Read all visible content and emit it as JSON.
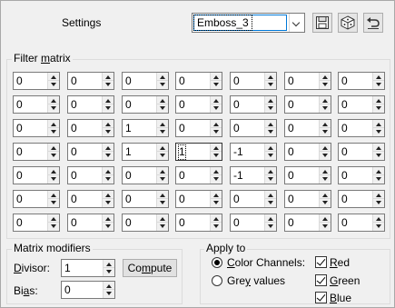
{
  "header": {
    "label": "Settings",
    "preset_value": "Emboss_3",
    "buttons": [
      "save-preset",
      "randomize",
      "reset"
    ]
  },
  "filter_matrix": {
    "title_prefix": "Filter ",
    "title_underlined": "m",
    "title_suffix": "atrix",
    "rows": [
      [
        "0",
        "0",
        "0",
        "0",
        "0",
        "0",
        "0"
      ],
      [
        "0",
        "0",
        "0",
        "0",
        "0",
        "0",
        "0"
      ],
      [
        "0",
        "0",
        "1",
        "0",
        "0",
        "0",
        "0"
      ],
      [
        "0",
        "0",
        "1",
        "1",
        "-1",
        "0",
        "0"
      ],
      [
        "0",
        "0",
        "0",
        "0",
        "-1",
        "0",
        "0"
      ],
      [
        "0",
        "0",
        "0",
        "0",
        "0",
        "0",
        "0"
      ],
      [
        "0",
        "0",
        "0",
        "0",
        "0",
        "0",
        "0"
      ]
    ],
    "focused": [
      3,
      3
    ]
  },
  "modifiers": {
    "title": "Matrix modifiers",
    "divisor_label_u": "D",
    "divisor_label_rest": "ivisor:",
    "divisor_value": "1",
    "compute_pre": "Co",
    "compute_u": "m",
    "compute_post": "pute",
    "bias_label_pre": "Bi",
    "bias_label_u": "a",
    "bias_label_post": "s:",
    "bias_value": "0"
  },
  "apply_to": {
    "title": "Apply to",
    "color_channels_u": "C",
    "color_channels_rest": "olor Channels:",
    "grey_pre": "Gre",
    "grey_u": "y",
    "grey_post": " values",
    "red_u": "R",
    "red_rest": "ed",
    "green_u": "G",
    "green_rest": "reen",
    "blue_u": "B",
    "blue_rest": "lue",
    "mode": "color"
  }
}
